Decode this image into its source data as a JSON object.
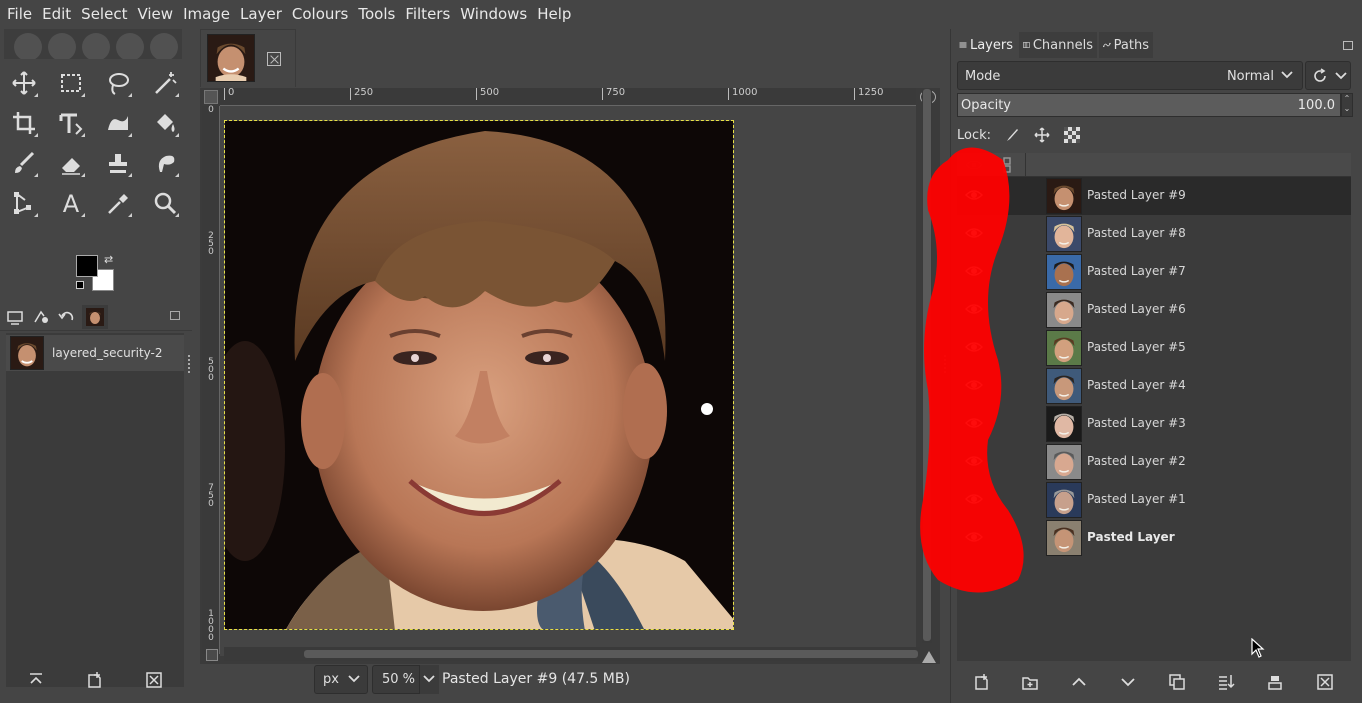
{
  "menubar": [
    "File",
    "Edit",
    "Select",
    "View",
    "Image",
    "Layer",
    "Colours",
    "Tools",
    "Filters",
    "Windows",
    "Help"
  ],
  "toolbox": {
    "tools": [
      "move-tool-icon",
      "rect-select-icon",
      "free-select-icon",
      "fuzzy-select-icon",
      "crop-icon",
      "unified-transform-icon",
      "warp-transform-icon",
      "bucket-fill-icon",
      "paintbrush-icon",
      "eraser-icon",
      "clone-icon",
      "smudge-icon",
      "paths-icon",
      "text-icon",
      "color-picker-icon",
      "zoom-icon"
    ],
    "fg_color": "#000000",
    "bg_color": "#ffffff"
  },
  "images_panel": {
    "image_name": "layered_security-2"
  },
  "canvas": {
    "ruler_h": [
      "0",
      "250",
      "500",
      "750",
      "1000",
      "1250"
    ],
    "ruler_v": [
      "0",
      "250",
      "500",
      "750",
      "1000"
    ]
  },
  "statusbar": {
    "unit": "px",
    "zoom": "50 %",
    "status_text": "Pasted Layer #9 (47.5 MB)"
  },
  "layers_dock": {
    "tabs": [
      "Layers",
      "Channels",
      "Paths"
    ],
    "mode_label": "Mode",
    "mode_value": "Normal",
    "opacity_label": "Opacity",
    "opacity_value": "100.0",
    "lock_label": "Lock:",
    "layers": [
      {
        "name": "Pasted Layer #9",
        "selected": true,
        "skin": "#c59070",
        "hair": "#6b4a2e",
        "bg": "#2a1a14"
      },
      {
        "name": "Pasted Layer #8",
        "selected": false,
        "skin": "#e2b59a",
        "hair": "#d8c39a",
        "bg": "#3c4a6a"
      },
      {
        "name": "Pasted Layer #7",
        "selected": false,
        "skin": "#a9714f",
        "hair": "#1e1a18",
        "bg": "#3a6aa8"
      },
      {
        "name": "Pasted Layer #6",
        "selected": false,
        "skin": "#d7a88c",
        "hair": "#3b2a20",
        "bg": "#8a8a8a"
      },
      {
        "name": "Pasted Layer #5",
        "selected": false,
        "skin": "#d2a07e",
        "hair": "#5a3a22",
        "bg": "#5b7a48"
      },
      {
        "name": "Pasted Layer #4",
        "selected": false,
        "skin": "#c8987a",
        "hair": "#2a2420",
        "bg": "#3f5a7a"
      },
      {
        "name": "Pasted Layer #3",
        "selected": false,
        "skin": "#e0b8a4",
        "hair": "#b8b0a8",
        "bg": "#1a1a1a"
      },
      {
        "name": "Pasted Layer #2",
        "selected": false,
        "skin": "#d8a890",
        "hair": "#5a5a5a",
        "bg": "#8a8a8a"
      },
      {
        "name": "Pasted Layer #1",
        "selected": false,
        "skin": "#c7a08c",
        "hair": "#9a9a9a",
        "bg": "#2a3a5a"
      },
      {
        "name": "Pasted Layer",
        "selected": false,
        "skin": "#c59476",
        "hair": "#4a3020",
        "bg": "#8a8070"
      }
    ]
  },
  "accent": {
    "selection_border": "#e8e046",
    "annotation_red": "#ff0000"
  }
}
